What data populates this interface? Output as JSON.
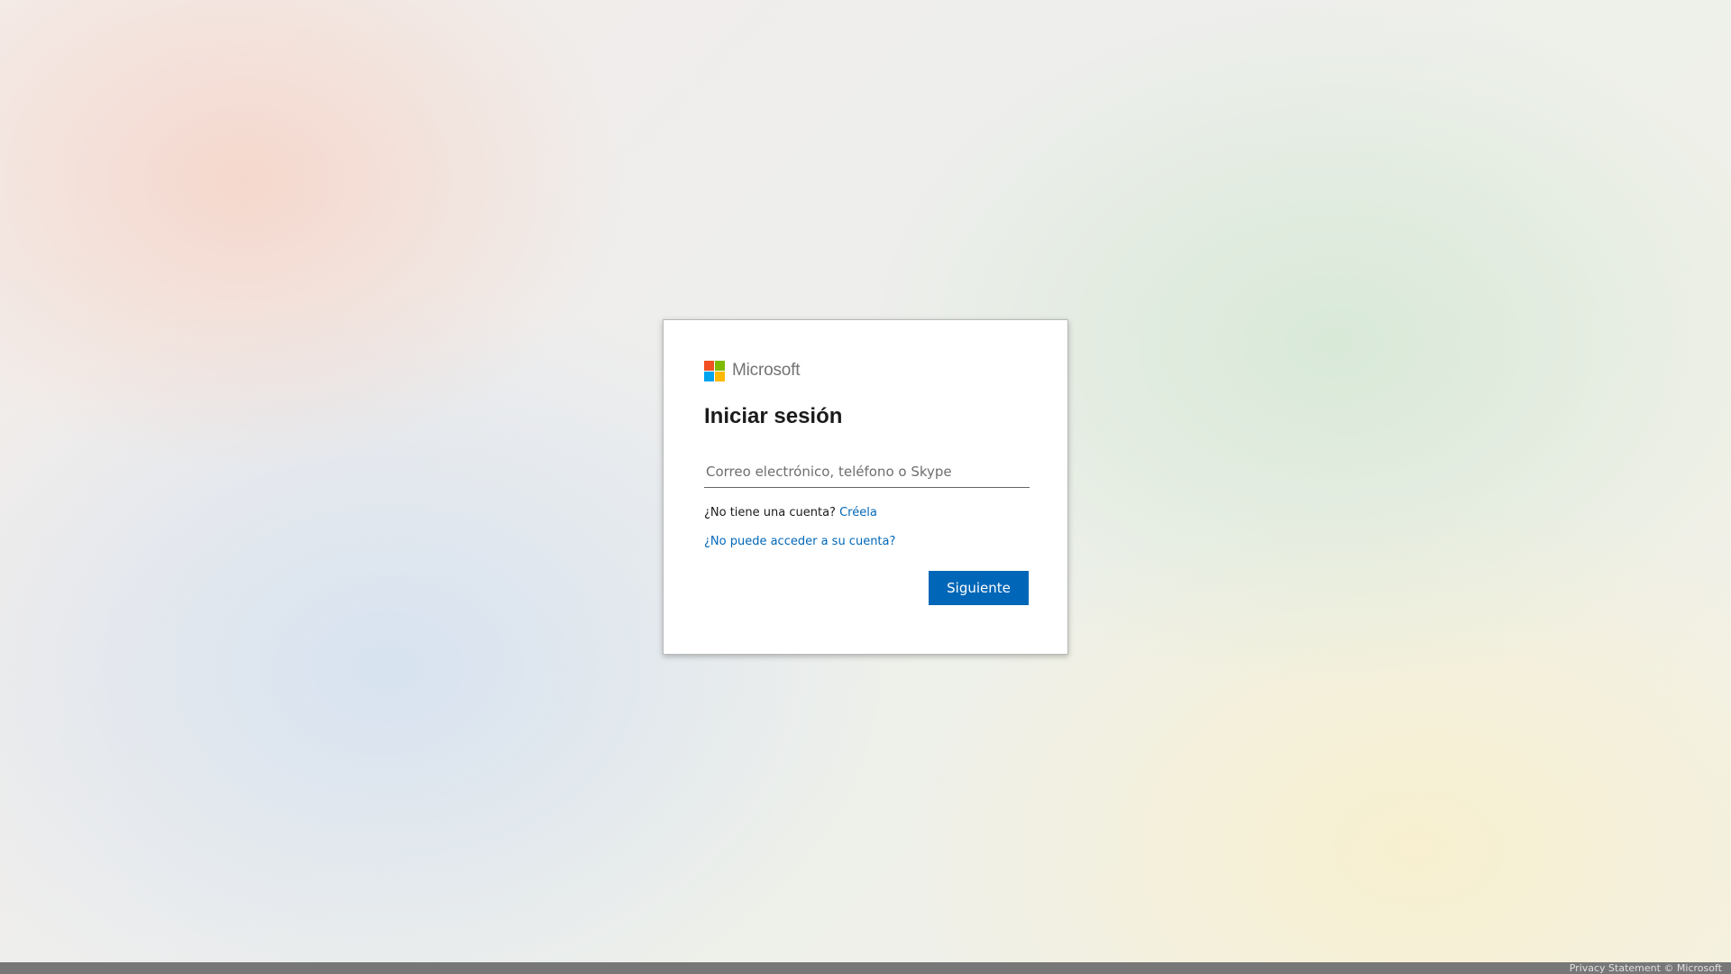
{
  "brand": {
    "name": "Microsoft",
    "logo_colors": [
      "#f25022",
      "#7fba00",
      "#00a4ef",
      "#ffb900"
    ]
  },
  "signin": {
    "title": "Iniciar sesión",
    "email_placeholder": "Correo electrónico, teléfono o Skype",
    "email_value": "",
    "no_account_text": "¿No tiene una cuenta?",
    "create_link": "Créela",
    "cant_access_link": "¿No puede acceder a su cuenta?",
    "next_button": "Siguiente"
  },
  "footer": {
    "text": "Privacy Statement © Microsoft"
  },
  "colors": {
    "accent": "#0067b8",
    "text": "#1b1b1b"
  }
}
